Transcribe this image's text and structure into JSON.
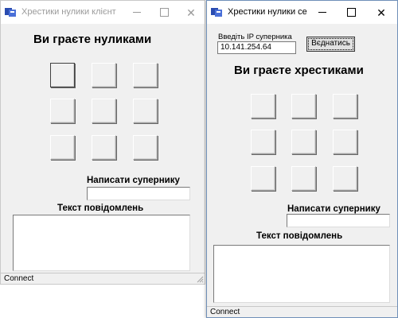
{
  "client_window": {
    "title": "Хрестики нулики клієнт",
    "heading": "Ви граєте нуликами",
    "board_cells": [
      "",
      "",
      "",
      "",
      "",
      "",
      "",
      "",
      ""
    ],
    "write_label": "Написати супернику",
    "message_input": "",
    "messages_label": "Текст повідомлень",
    "messages_text": "",
    "status": "Connect"
  },
  "server_window": {
    "title": "Хрестики нулики се...",
    "ip_label": "Введіть IP суперника",
    "ip_value": "10.141.254.64",
    "connect_label": "Вєднатись",
    "heading": "Ви граєте хрестиками",
    "board_cells": [
      "",
      "",
      "",
      "",
      "",
      "",
      "",
      "",
      ""
    ],
    "write_label": "Написати супернику",
    "message_input": "",
    "messages_label": "Текст повідомлень",
    "messages_text": "",
    "status": "Connect"
  },
  "icons": {
    "app": "app-window-icon",
    "minimize": "minimize-icon",
    "maximize": "maximize-icon",
    "close": "close-icon",
    "resize": "resize-grip-icon"
  }
}
